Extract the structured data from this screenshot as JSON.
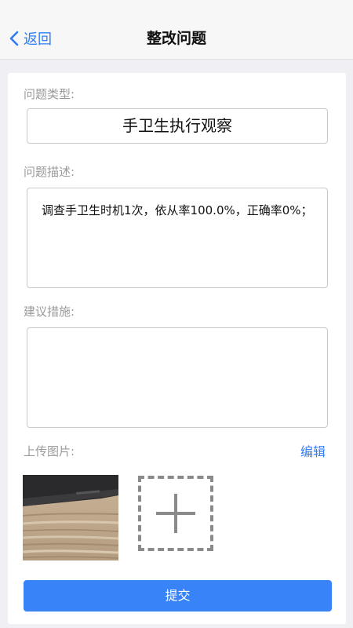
{
  "header": {
    "back_label": "返回",
    "title": "整改问题"
  },
  "form": {
    "type_label": "问题类型:",
    "type_value": "手卫生执行观察",
    "description_label": "问题描述:",
    "description_value": "调查手卫生时机1次，依从率100.0%，正确率0%；",
    "suggestion_label": "建议措施:",
    "suggestion_value": "",
    "upload_label": "上传图片:",
    "edit_label": "编辑",
    "submit_label": "提交"
  },
  "icons": {
    "back": "chevron-left-icon",
    "add": "plus-icon"
  },
  "colors": {
    "accent": "#3883f8",
    "link": "#2f7cf6",
    "label": "#9a9a9a",
    "background": "#efeff4"
  }
}
